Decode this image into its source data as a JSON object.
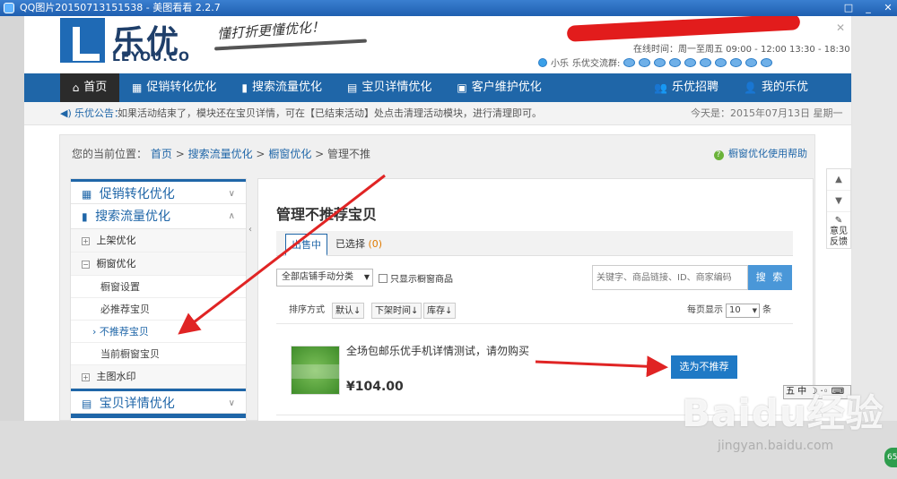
{
  "viewer": {
    "title": "QQ图片20150713151538 - 美图看看 2.2.7",
    "controls": [
      "□",
      "_",
      "✕"
    ]
  },
  "header": {
    "logo_text": "乐优",
    "logo_sub": "LEYOU.CO",
    "slogan": "懂打折更懂优化！",
    "online_time": "在线时间：周一至周五  09:00 - 12:00  13:30 - 18:30",
    "qq_label": "小乐",
    "qq_group_label": "乐优交流群:"
  },
  "nav": {
    "home": "首页",
    "items": [
      "促销转化优化",
      "搜索流量优化",
      "宝贝详情优化",
      "客户维护优化"
    ],
    "right": [
      "乐优招聘",
      "我的乐优"
    ]
  },
  "notice": {
    "label": "乐优公告：",
    "text": "如果活动结束了，模块还在宝贝详情，可在【已结束活动】处点击清理活动模块，进行清理即可。",
    "date": "今天是：2015年07月13日  星期一"
  },
  "breadcrumb": {
    "prefix": "您的当前位置：",
    "links": [
      "首页",
      "搜索流量优化",
      "橱窗优化"
    ],
    "current": "管理不推",
    "sep": ">"
  },
  "help": {
    "label": "橱窗优化使用帮助"
  },
  "sidebar": {
    "section1": "促销转化优化",
    "section2": "搜索流量优化",
    "sub1": "上架优化",
    "sub2": "橱窗优化",
    "leaves": [
      "橱窗设置",
      "必推荐宝贝",
      "不推荐宝贝",
      "当前橱窗宝贝"
    ],
    "sub3": "主图水印",
    "section3": "宝贝详情优化"
  },
  "main": {
    "title": "管理不推荐宝贝",
    "tab_active": "出售中",
    "tab_second": "已选择",
    "tab_second_count": "(0)",
    "category_select": "全部店铺手动分类",
    "only_window_label": "只显示橱窗商品",
    "search_placeholder": "关键字、商品链接、ID、商家编码",
    "search_btn": "搜 索",
    "sort_label": "排序方式",
    "sort_options": [
      "默认",
      "下架时间",
      "库存"
    ],
    "perpage_label": "每页显示",
    "perpage_value": "10",
    "perpage_unit": "条"
  },
  "product": {
    "name": "全场包邮乐优手机详情测试，请勿购买",
    "price": "¥104.00",
    "action": "选为不推荐"
  },
  "right_tools": {
    "up": "▲",
    "down": "▼",
    "feedback": "意见反馈"
  },
  "ime": {
    "text": "五 中 ☽ ·◦ ⌨"
  },
  "watermark": {
    "main": "Baidu经验",
    "sub": "jingyan.baidu.com"
  },
  "badge": "65"
}
